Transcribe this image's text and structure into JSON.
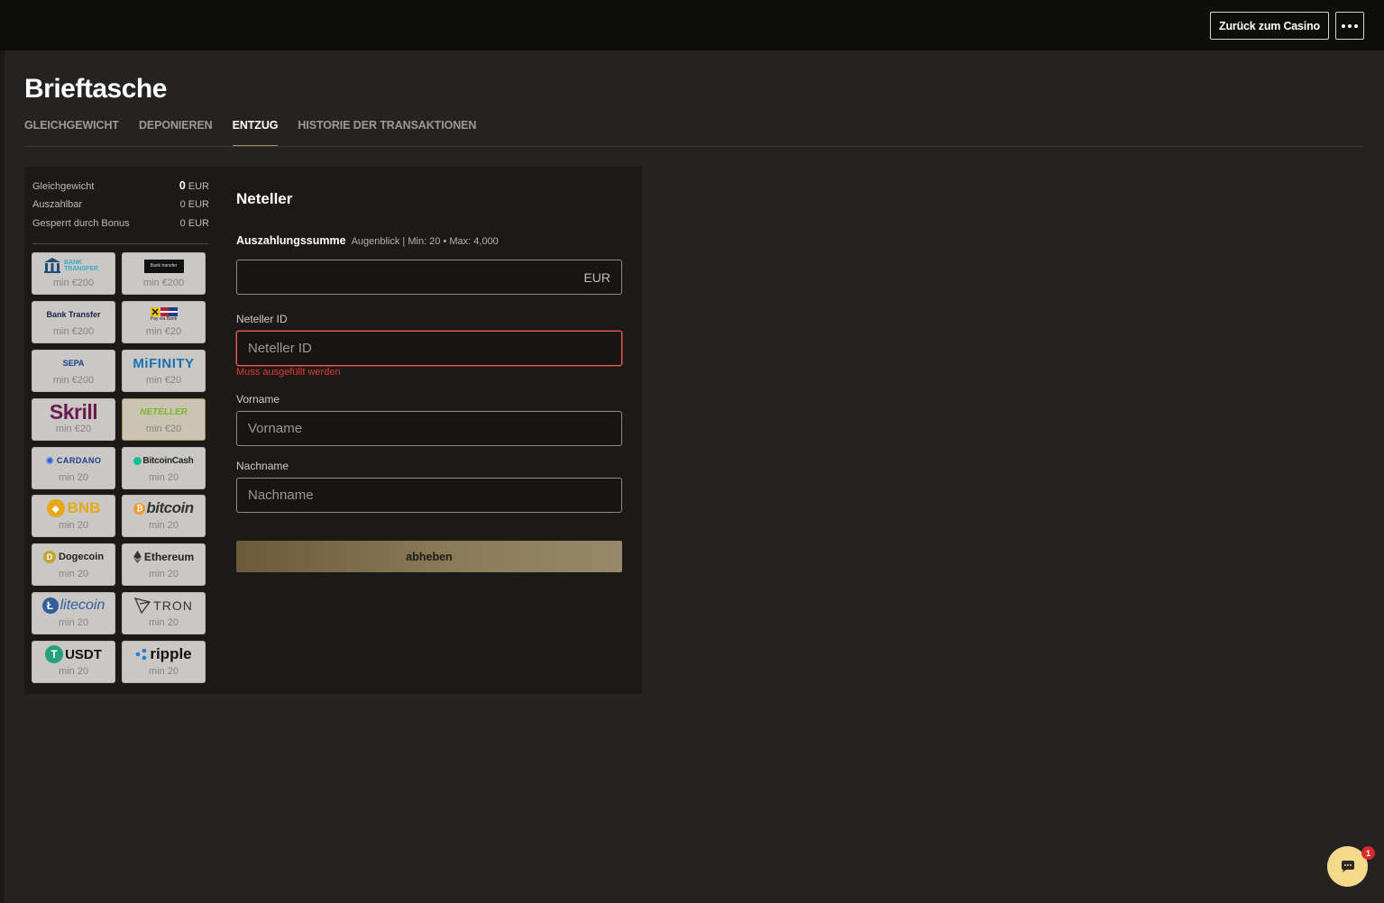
{
  "header": {
    "casino_button": "Zurück zum Casino",
    "more_icon": "more-dots-icon"
  },
  "page": {
    "title": "Brieftasche"
  },
  "tabs": [
    {
      "label": "GLEICHGEWICHT"
    },
    {
      "label": "DEPONIEREN"
    },
    {
      "label": "ENTZUG",
      "active": true
    },
    {
      "label": "HISTORIE DER TRANSAKTIONEN"
    }
  ],
  "balance": {
    "total_label": "Gleichgewicht",
    "total_value": "0",
    "total_currency": "EUR",
    "withdrawable_label": "Auszahlbar",
    "withdrawable_value": "0 EUR",
    "bonus_label": "Gesperrt durch Bonus",
    "bonus_value": "0 EUR"
  },
  "methods": [
    {
      "name": "BANK TRANSFER",
      "min": "min €200"
    },
    {
      "name": "Bank transfer",
      "min": "min €200"
    },
    {
      "name": "Bank Transfer",
      "min": "min €200"
    },
    {
      "name": "Pay via Bank",
      "min": "min €20"
    },
    {
      "name": "SEPA",
      "min": "min €200"
    },
    {
      "name": "MiFINITY",
      "min": "min €20"
    },
    {
      "name": "Skrill",
      "min": "min €20"
    },
    {
      "name": "NETELLER",
      "min": "min €20",
      "selected": true
    },
    {
      "name": "CARDANO",
      "min": "min 20"
    },
    {
      "name": "BitcoinCash",
      "min": "min 20"
    },
    {
      "name": "BNB",
      "min": "min 20"
    },
    {
      "name": "bitcoin",
      "min": "min 20"
    },
    {
      "name": "Dogecoin",
      "min": "min 20"
    },
    {
      "name": "Ethereum",
      "min": "min 20"
    },
    {
      "name": "litecoin",
      "min": "min 20"
    },
    {
      "name": "TRON",
      "min": "min 20"
    },
    {
      "name": "USDT",
      "min": "min 20"
    },
    {
      "name": "ripple",
      "min": "min 20"
    }
  ],
  "form": {
    "title": "Neteller",
    "amount_label": "Auszahlungssumme",
    "amount_hint": "Augenblick | Min: 20 • Max: 4,000",
    "amount_currency": "EUR",
    "neteller_id_label": "Neteller ID",
    "neteller_id_placeholder": "Neteller ID",
    "neteller_id_error": "Muss ausgefüllt werden",
    "firstname_label": "Vorname",
    "firstname_placeholder": "Vorname",
    "lastname_label": "Nachname",
    "lastname_placeholder": "Nachname",
    "submit": "abheben"
  },
  "chat": {
    "badge": "1"
  },
  "colors": {
    "accent": "#a58f5f",
    "error": "#e03a32",
    "background": "#242321",
    "panel": "#1b1a18"
  }
}
